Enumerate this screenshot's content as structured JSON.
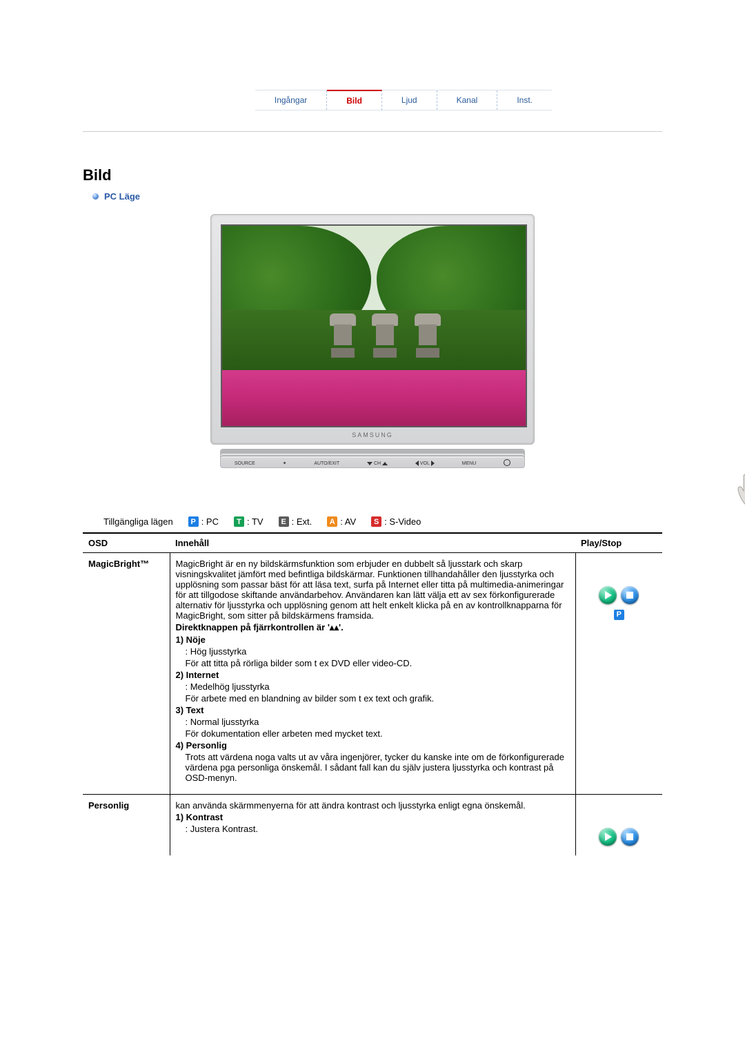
{
  "tabs": [
    "Ingångar",
    "Bild",
    "Ljud",
    "Kanal",
    "Inst."
  ],
  "active_tab": "Bild",
  "section_title": "Bild",
  "subsection": "PC Läge",
  "monitor_brand": "SAMSUNG",
  "control_buttons": {
    "source": "SOURCE",
    "auto": "AUTO/EXIT",
    "ch": "CH",
    "vol": "VOL",
    "menu": "MENU"
  },
  "modes_label": "Tillgängliga lägen",
  "modes": [
    {
      "badge": "P",
      "cls": "bg-P",
      "label": ": PC"
    },
    {
      "badge": "T",
      "cls": "bg-T",
      "label": ": TV"
    },
    {
      "badge": "E",
      "cls": "bg-E",
      "label": ": Ext."
    },
    {
      "badge": "A",
      "cls": "bg-A",
      "label": ": AV"
    },
    {
      "badge": "S",
      "cls": "bg-S",
      "label": ": S-Video"
    }
  ],
  "table": {
    "headers": {
      "osd": "OSD",
      "content": "Innehåll",
      "play": "Play/Stop"
    },
    "rows": [
      {
        "osd": "MagicBright™",
        "intro": "MagicBright är en ny bildskärmsfunktion som erbjuder en dubbelt så ljusstark och skarp visningskvalitet jämfört med befintliga bildskärmar. Funktionen tillhandahåller den ljusstyrka och upplösning som passar bäst för att läsa text, surfa på Internet eller titta på multimedia-animeringar för att tillgodose skiftande användarbehov. Användaren kan lätt välja ett av sex förkonfigurerade alternativ för ljusstyrka och upplösning genom att helt enkelt klicka på en av kontrollknapparna för MagicBright, som sitter på bildskärmens framsida.",
        "direct": "Direktknappen på fjärrkontrollen är '▴▴'.",
        "items": [
          {
            "t": "1) Nöje",
            "s": ": Hög ljusstyrka",
            "d": "För att titta på rörliga bilder som t ex DVD eller video-CD."
          },
          {
            "t": "2) Internet",
            "s": ": Medelhög ljusstyrka",
            "d": "För arbete med en blandning av bilder som t ex text och grafik."
          },
          {
            "t": "3) Text",
            "s": ": Normal ljusstyrka",
            "d": "För dokumentation eller arbeten med mycket text."
          },
          {
            "t": "4) Personlig",
            "s": "",
            "d": "Trots att värdena noga valts ut av våra ingenjörer, tycker du kanske inte om de förkonfigurerade värdena pga personliga önskemål. I sådant fall kan du själv justera ljusstyrka och kontrast på OSD-menyn."
          }
        ],
        "play_mode": {
          "badge": "P",
          "cls": "bg-P"
        }
      },
      {
        "osd": "Personlig",
        "intro": "kan använda skärmmenyerna för att ändra kontrast och ljusstyrka enligt egna önskemål.",
        "items2": [
          {
            "t": "1) Kontrast",
            "s": ": Justera Kontrast."
          }
        ]
      }
    ]
  }
}
